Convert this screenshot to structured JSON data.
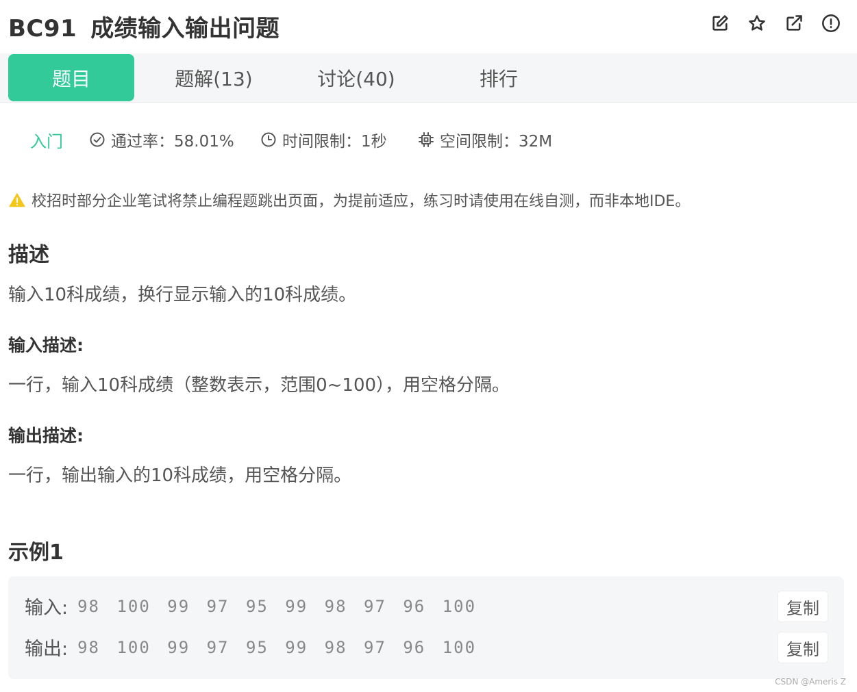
{
  "problem": {
    "code": "BC91",
    "title": "成绩输入输出问题"
  },
  "header_icons": [
    "edit-icon",
    "star-icon",
    "external-link-icon",
    "alert-circle-icon"
  ],
  "tabs": [
    {
      "label": "题目",
      "active": true
    },
    {
      "label": "题解(13)",
      "active": false
    },
    {
      "label": "讨论(40)",
      "active": false
    },
    {
      "label": "排行",
      "active": false
    }
  ],
  "meta": {
    "level": "入门",
    "pass_rate": "通过率：58.01%",
    "time_limit": "时间限制：1秒",
    "space_limit": "空间限制：32M"
  },
  "notice": "校招时部分企业笔试将禁止编程题跳出页面，为提前适应，练习时请使用在线自测，而非本地IDE。",
  "description": {
    "heading": "描述",
    "text": "输入10科成绩，换行显示输入的10科成绩。"
  },
  "input_desc": {
    "heading": "输入描述:",
    "text": "一行，输入10科成绩（整数表示，范围0~100），用空格分隔。"
  },
  "output_desc": {
    "heading": "输出描述:",
    "text": "一行，输出输入的10科成绩，用空格分隔。"
  },
  "example": {
    "heading": "示例1",
    "input_label": "输入:",
    "input_value": "98 100 99 97 95 99 98 97 96 100",
    "output_label": "输出:",
    "output_value": "98 100 99 97 95 99 98 97 96 100",
    "copy_label": "复制"
  },
  "colors": {
    "accent": "#32ca99",
    "warning": "#f5c518",
    "tabbar_bg": "#f5f6f7"
  },
  "watermark": "CSDN @Ameris Z"
}
